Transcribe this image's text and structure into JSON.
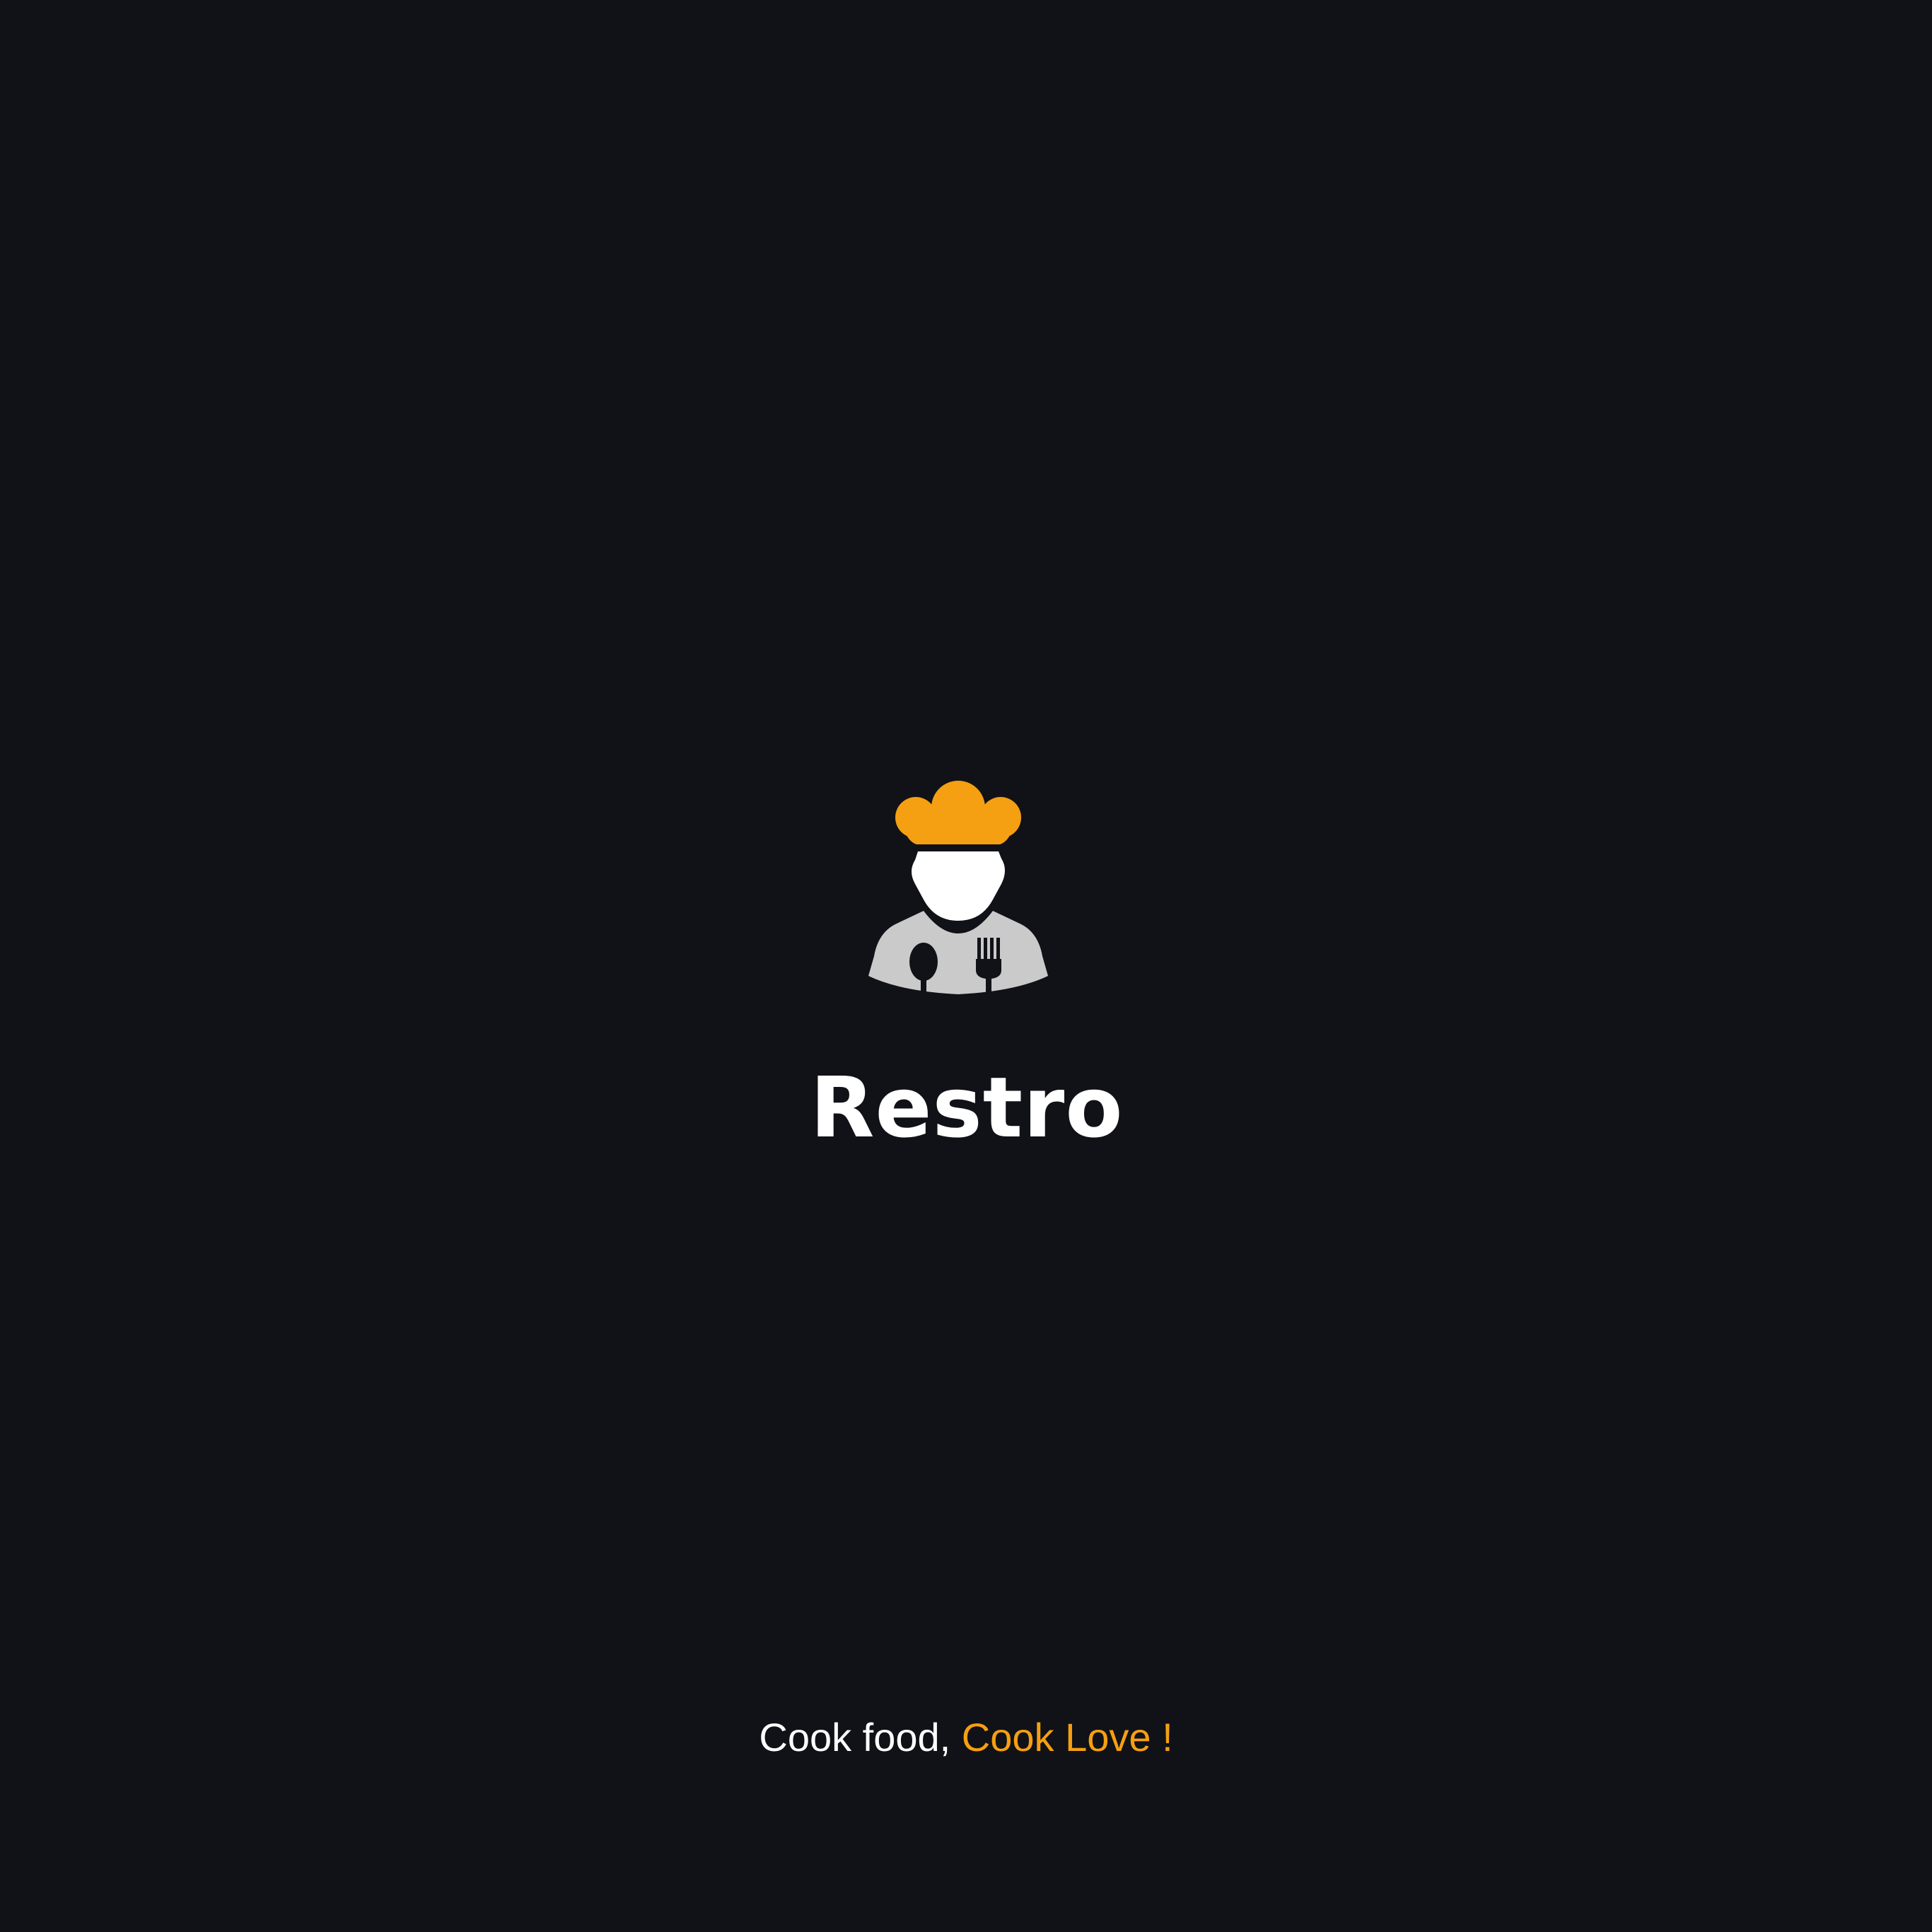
{
  "app": {
    "name": "Restro",
    "logo_icon": "chef-with-spoon-and-fork-icon"
  },
  "tagline": {
    "part1": "Cook food, ",
    "part2": "Cook Love !"
  },
  "colors": {
    "background": "#111217",
    "accent": "#f59f13",
    "text": "#ffffff",
    "shirt": "#cacaca"
  }
}
